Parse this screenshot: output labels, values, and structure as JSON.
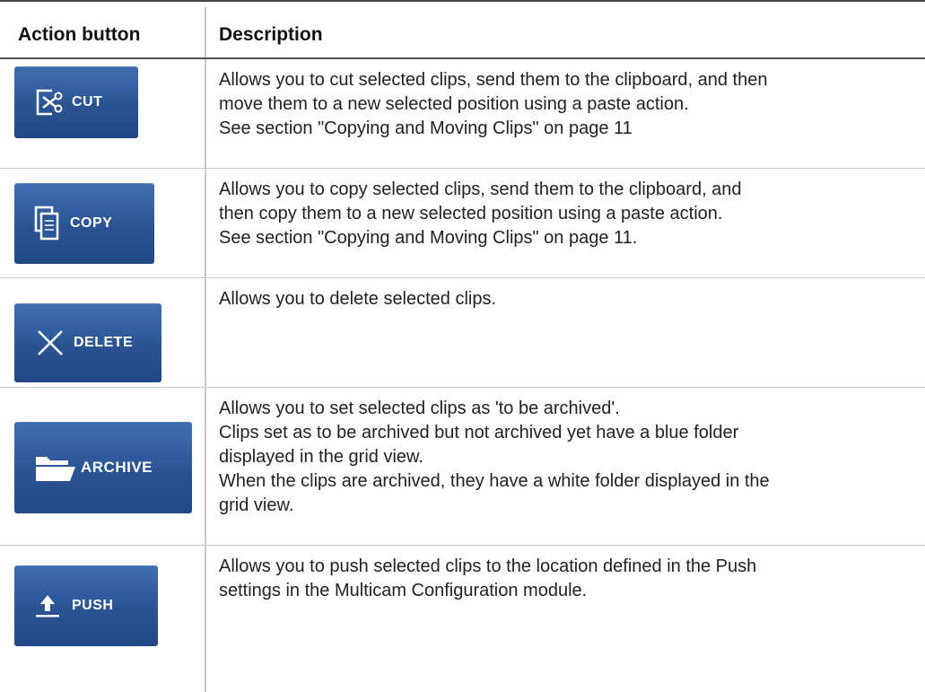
{
  "header": {
    "col1": "Action button",
    "col2": "Description"
  },
  "rows": [
    {
      "button": "CUT",
      "icon": "scissors-icon",
      "lines": [
        "Allows you to cut selected clips, send them to the clipboard, and then",
        "move them to a new selected position using a paste action.",
        "See section \"Copying and Moving Clips\" on page 11"
      ]
    },
    {
      "button": "COPY",
      "icon": "copy-icon",
      "lines": [
        "Allows you to copy selected clips, send them to the clipboard, and",
        "then copy them to a new selected position using a paste action.",
        "See section \"Copying and Moving Clips\" on page 11."
      ]
    },
    {
      "button": "DELETE",
      "icon": "x-icon",
      "lines": [
        "Allows you to delete selected clips."
      ]
    },
    {
      "button": "ARCHIVE",
      "icon": "folder-icon",
      "lines": [
        "Allows you to set selected clips as 'to be archived'.",
        "Clips set as to be archived but not archived yet have a blue folder",
        "displayed in the grid view.",
        "When the clips are archived, they have a white folder displayed in the",
        "grid view."
      ]
    },
    {
      "button": "PUSH",
      "icon": "upload-icon",
      "lines": [
        "Allows you to push selected clips to the location defined in the Push",
        "settings in the Multicam Configuration module."
      ]
    }
  ],
  "colors": {
    "button_top": "#3f6fb1",
    "button_bottom": "#224785",
    "rule": "#c8c8c8"
  }
}
